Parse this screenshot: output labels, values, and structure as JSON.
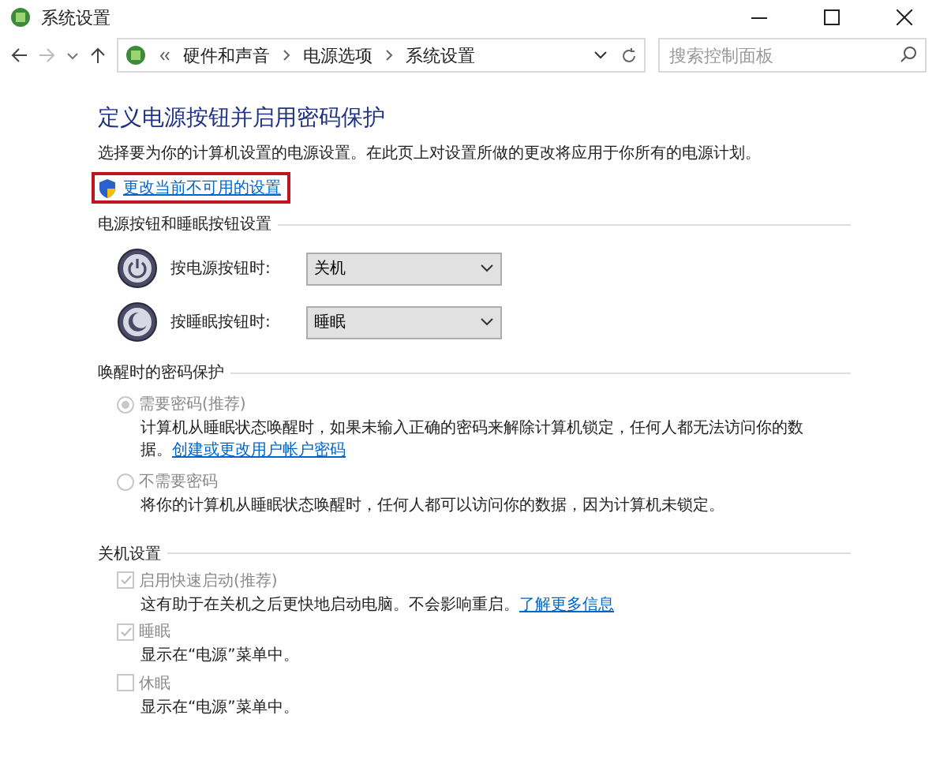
{
  "window": {
    "title": "系统设置"
  },
  "nav": {
    "breadcrumb": [
      "硬件和声音",
      "电源选项",
      "系统设置"
    ],
    "search": {
      "placeholder": "搜索控制面板"
    }
  },
  "heading": "定义电源按钮并启用密码保护",
  "description": "选择要为你的计算机设置的电源设置。在此页上对设置所做的更改将应用于你所有的电源计划。",
  "admin_link": {
    "label": "更改当前不可用的设置",
    "highlighted": true
  },
  "power_section": {
    "title": "电源按钮和睡眠按钮设置",
    "rows": [
      {
        "kind": "power",
        "label": "按电源按钮时:",
        "value": "关机"
      },
      {
        "kind": "sleep",
        "label": "按睡眠按钮时:",
        "value": "睡眠"
      }
    ]
  },
  "password_section": {
    "title": "唤醒时的密码保护",
    "options": [
      {
        "label": "需要密码(推荐)",
        "selected": true,
        "disabled": true,
        "description": "计算机从睡眠状态唤醒时，如果未输入正确的密码来解除计算机锁定，任何人都无法访问你的数据。",
        "link": "创建或更改用户帐户密码"
      },
      {
        "label": "不需要密码",
        "selected": false,
        "disabled": true,
        "description": "将你的计算机从睡眠状态唤醒时，任何人都可以访问你的数据，因为计算机未锁定。"
      }
    ]
  },
  "shutdown_section": {
    "title": "关机设置",
    "options": [
      {
        "label": "启用快速启动(推荐)",
        "checked": true,
        "disabled": true,
        "description": "这有助于在关机之后更快地启动电脑。不会影响重启。",
        "link": "了解更多信息"
      },
      {
        "label": "睡眠",
        "checked": true,
        "disabled": true,
        "description": "显示在“电源”菜单中。"
      },
      {
        "label": "休眠",
        "checked": false,
        "disabled": true,
        "description": "显示在“电源”菜单中。"
      }
    ]
  }
}
